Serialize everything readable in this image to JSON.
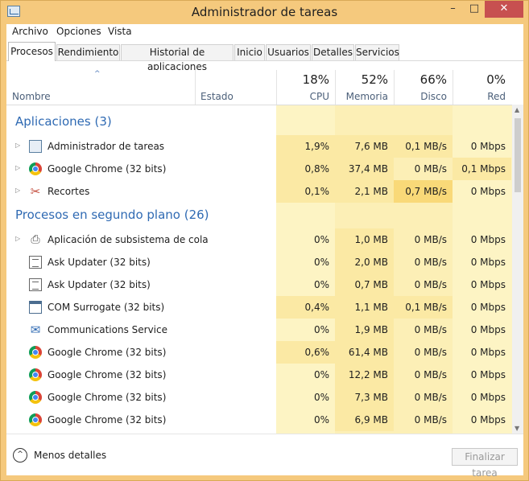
{
  "window": {
    "title": "Administrador de tareas",
    "min": "–",
    "max": "□",
    "close": "✕"
  },
  "menu": [
    "Archivo",
    "Opciones",
    "Vista"
  ],
  "tabs": [
    "Procesos",
    "Rendimiento",
    "Historial de aplicaciones",
    "Inicio",
    "Usuarios",
    "Detalles",
    "Servicios"
  ],
  "active_tab": "Procesos",
  "columns": {
    "name": "Nombre",
    "status": "Estado",
    "cpu": {
      "pct": "18%",
      "label": "CPU"
    },
    "mem": {
      "pct": "52%",
      "label": "Memoria"
    },
    "disk": {
      "pct": "66%",
      "label": "Disco"
    },
    "net": {
      "pct": "0%",
      "label": "Red"
    },
    "sort_glyph": "^"
  },
  "groups": [
    {
      "title": "Aplicaciones (3)",
      "rows": [
        {
          "icon": "task-manager-icon",
          "expand": "▷",
          "name": "Administrador de tareas",
          "cpu": "1,9%",
          "mem": "7,6 MB",
          "disk": "0,1 MB/s",
          "net": "0 Mbps"
        },
        {
          "icon": "chrome-icon",
          "expand": "▷",
          "name": "Google Chrome (32 bits)",
          "cpu": "0,8%",
          "mem": "37,4 MB",
          "disk": "0 MB/s",
          "net": "0,1 Mbps"
        },
        {
          "icon": "scissors-icon",
          "expand": "▷",
          "name": "Recortes",
          "cpu": "0,1%",
          "mem": "2,1 MB",
          "disk": "0,7 MB/s",
          "net": "0 Mbps"
        }
      ]
    },
    {
      "title": "Procesos en segundo plano (26)",
      "rows": [
        {
          "icon": "printer-icon",
          "expand": "▷",
          "name": "Aplicación de subsistema de cola",
          "cpu": "0%",
          "mem": "1,0 MB",
          "disk": "0 MB/s",
          "net": "0 Mbps"
        },
        {
          "icon": "document-icon",
          "expand": "",
          "name": "Ask Updater (32 bits)",
          "cpu": "0%",
          "mem": "2,0 MB",
          "disk": "0 MB/s",
          "net": "0 Mbps"
        },
        {
          "icon": "document-icon",
          "expand": "",
          "name": "Ask Updater (32 bits)",
          "cpu": "0%",
          "mem": "0,7 MB",
          "disk": "0 MB/s",
          "net": "0 Mbps"
        },
        {
          "icon": "window-icon",
          "expand": "",
          "name": "COM Surrogate (32 bits)",
          "cpu": "0,4%",
          "mem": "1,1 MB",
          "disk": "0,1 MB/s",
          "net": "0 Mbps"
        },
        {
          "icon": "mail-icon",
          "expand": "",
          "name": "Communications Service",
          "cpu": "0%",
          "mem": "1,9 MB",
          "disk": "0 MB/s",
          "net": "0 Mbps"
        },
        {
          "icon": "chrome-icon",
          "expand": "",
          "name": "Google Chrome (32 bits)",
          "cpu": "0,6%",
          "mem": "61,4 MB",
          "disk": "0 MB/s",
          "net": "0 Mbps"
        },
        {
          "icon": "chrome-icon",
          "expand": "",
          "name": "Google Chrome (32 bits)",
          "cpu": "0%",
          "mem": "12,2 MB",
          "disk": "0 MB/s",
          "net": "0 Mbps"
        },
        {
          "icon": "chrome-icon",
          "expand": "",
          "name": "Google Chrome (32 bits)",
          "cpu": "0%",
          "mem": "7,3 MB",
          "disk": "0 MB/s",
          "net": "0 Mbps"
        },
        {
          "icon": "chrome-icon",
          "expand": "",
          "name": "Google Chrome (32 bits)",
          "cpu": "0%",
          "mem": "6,9 MB",
          "disk": "0 MB/s",
          "net": "0 Mbps"
        }
      ]
    }
  ],
  "footer": {
    "less_details": "Menos detalles",
    "less_glyph": "^",
    "end_task": "Finalizar tarea"
  },
  "colors": {
    "shade_light": "#fdf4c4",
    "shade_mid": "#fbe9a4",
    "shade_strong": "#f9d978",
    "group_title": "#2f6ab3"
  }
}
